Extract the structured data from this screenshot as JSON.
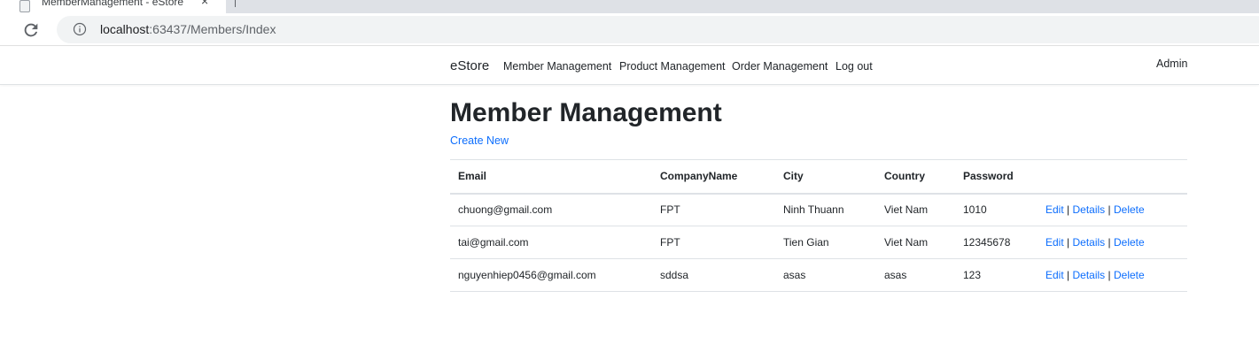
{
  "browser": {
    "tab_title": "MemberManagement - eStore",
    "tab_close": "×",
    "url_host": "localhost",
    "url_rest": ":63437/Members/Index",
    "icons": {
      "reload": "reload-icon",
      "info": "info-icon",
      "favicon": "page-icon",
      "close": "close-icon"
    }
  },
  "navbar": {
    "brand": "eStore",
    "links": [
      "Member Management",
      "Product Management",
      "Order Management",
      "Log out"
    ],
    "user": "Admin"
  },
  "main": {
    "title": "Member Management",
    "create_new": "Create New",
    "table": {
      "headers": [
        "Email",
        "CompanyName",
        "City",
        "Country",
        "Password",
        ""
      ],
      "rows": [
        {
          "email": "chuong@gmail.com",
          "company": "FPT",
          "city": "Ninh Thuann",
          "country": "Viet Nam",
          "password": "1010"
        },
        {
          "email": "tai@gmail.com",
          "company": "FPT",
          "city": "Tien Gian",
          "country": "Viet Nam",
          "password": "12345678"
        },
        {
          "email": "nguyenhiep0456@gmail.com",
          "company": "sddsa",
          "city": "asas",
          "country": "asas",
          "password": "123"
        }
      ],
      "actions": {
        "edit": "Edit",
        "details": "Details",
        "delete": "Delete",
        "separator": "|"
      }
    }
  },
  "colors": {
    "link": "#0d6efd",
    "text": "#212529",
    "border": "#dee2e6",
    "omnibox": "#f1f3f4"
  }
}
